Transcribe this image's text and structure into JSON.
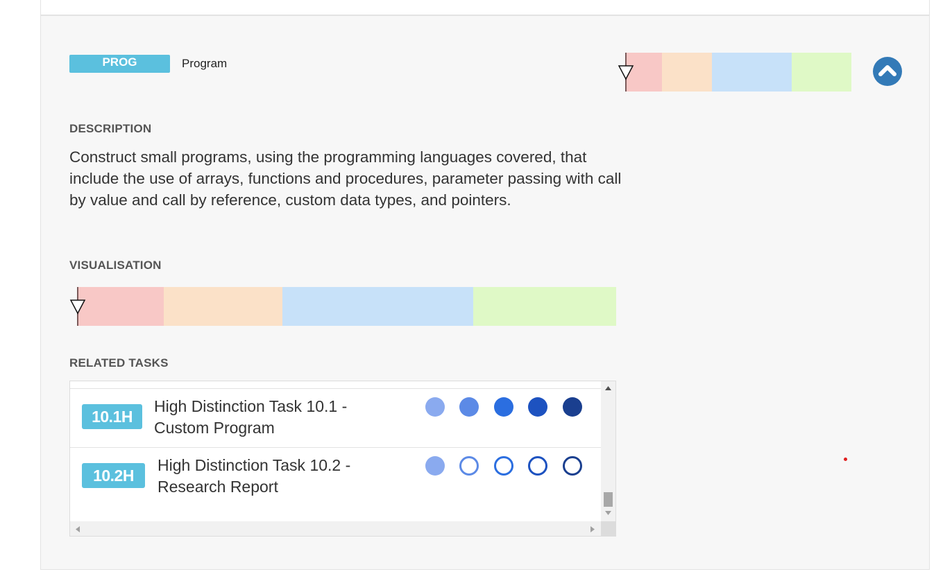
{
  "ilo": {
    "abbreviation": "PROG",
    "name": "Program",
    "badge_color": "#5bc0de"
  },
  "sections": {
    "description_label": "DESCRIPTION",
    "visualisation_label": "VISUALISATION",
    "related_tasks_label": "RELATED TASKS"
  },
  "description": "Construct small programs, using the programming languages covered, that include the use of arrays, functions and procedures, parameter passing with call by value and call by reference, custom data types, and pointers.",
  "grade_colors": {
    "pass": "#f8c8c6",
    "credit": "#fbe1c8",
    "distinction": "#c7e1f9",
    "high_distinction": "#dff9c6"
  },
  "icons": {
    "collapse": "chevron-up-icon",
    "marker": "triangle-down-icon"
  },
  "tasks": [
    {
      "code": "10.1H",
      "title_line1": "High Distinction Task 10.1 -",
      "title_line2": "Custom Program",
      "alignment_filled": [
        true,
        true,
        true,
        true,
        true
      ]
    },
    {
      "code": "10.2H",
      "title_line1": "High Distinction Task 10.2 -",
      "title_line2": "Research Report",
      "alignment_filled": [
        true,
        false,
        false,
        false,
        false
      ]
    }
  ],
  "alignment_colors": [
    "#8aaaef",
    "#5c8ae6",
    "#2b6ee0",
    "#1d52c0",
    "#1a3f8f"
  ]
}
